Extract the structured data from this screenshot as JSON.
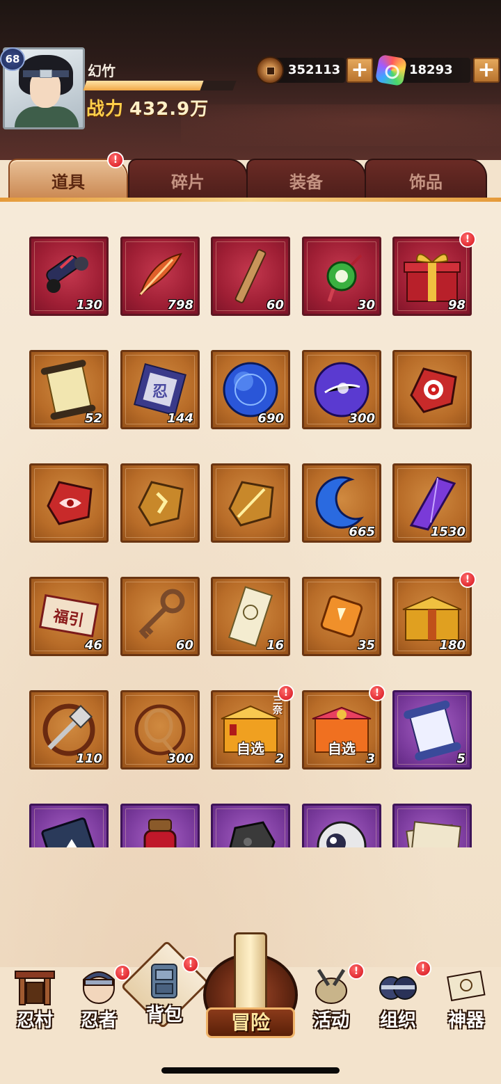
{
  "player": {
    "level": "68",
    "name": "幻竹",
    "power_label": "战力",
    "power_value": "432.9万",
    "exp_progress": 0.78
  },
  "currencies": {
    "copper": {
      "icon": "copper-coin-icon",
      "value": "352113"
    },
    "gem": {
      "icon": "rainbow-gem-icon",
      "value": "18293"
    },
    "add_label": "+"
  },
  "tabs": [
    {
      "label": "道具",
      "active": true,
      "badge": "!"
    },
    {
      "label": "碎片",
      "active": false
    },
    {
      "label": "装备",
      "active": false
    },
    {
      "label": "饰品",
      "active": false
    }
  ],
  "items": [
    {
      "icon": "scroll-icon",
      "frame": "red",
      "count": "130"
    },
    {
      "icon": "feather-icon",
      "frame": "red",
      "count": "798"
    },
    {
      "icon": "wooden-stick-icon",
      "frame": "red",
      "count": "60"
    },
    {
      "icon": "jade-pendant-icon",
      "frame": "red",
      "count": "30"
    },
    {
      "icon": "gift-box-icon",
      "frame": "red",
      "count": "98",
      "badge": "!"
    },
    {
      "icon": "open-scroll-icon",
      "frame": "brown",
      "count": "52"
    },
    {
      "icon": "talisman-cloth-icon",
      "frame": "brown",
      "count": "144"
    },
    {
      "icon": "blue-orb-icon",
      "frame": "brown",
      "count": "690"
    },
    {
      "icon": "purple-orb-icon",
      "frame": "brown",
      "count": "300"
    },
    {
      "icon": "red-target-stone-icon",
      "frame": "brown",
      "count": ""
    },
    {
      "icon": "red-eye-stone-icon",
      "frame": "brown",
      "count": ""
    },
    {
      "icon": "gold-rune-stone-icon",
      "frame": "brown",
      "count": ""
    },
    {
      "icon": "gold-blade-stone-icon",
      "frame": "brown",
      "count": ""
    },
    {
      "icon": "crescent-moon-icon",
      "frame": "brown",
      "count": "665"
    },
    {
      "icon": "purple-crystal-icon",
      "frame": "brown",
      "count": "1530"
    },
    {
      "icon": "fortune-banner-icon",
      "frame": "brown",
      "count": "46",
      "text": "福引"
    },
    {
      "icon": "bronze-key-icon",
      "frame": "brown",
      "count": "60"
    },
    {
      "icon": "paper-charm-icon",
      "frame": "brown",
      "count": "16"
    },
    {
      "icon": "amber-cube-icon",
      "frame": "brown",
      "count": "35"
    },
    {
      "icon": "golden-box-icon",
      "frame": "brown",
      "count": "180",
      "badge": "!"
    },
    {
      "icon": "shuriken-whirl-icon",
      "frame": "brown",
      "count": "110"
    },
    {
      "icon": "rope-whirl-icon",
      "frame": "brown",
      "count": "300"
    },
    {
      "icon": "select-chest-icon",
      "frame": "brown",
      "count": "2",
      "tag": "自选",
      "side": "三奈",
      "badge": "!"
    },
    {
      "icon": "select-chest-red-icon",
      "frame": "brown",
      "count": "3",
      "tag": "自选",
      "badge": "!"
    },
    {
      "icon": "blue-scroll-icon",
      "frame": "purple",
      "count": "5"
    },
    {
      "icon": "book-icon",
      "frame": "purple",
      "count": ""
    },
    {
      "icon": "potion-jar-icon",
      "frame": "purple",
      "count": ""
    },
    {
      "icon": "dark-ore-icon",
      "frame": "purple",
      "count": ""
    },
    {
      "icon": "eyeball-icon",
      "frame": "purple",
      "count": ""
    },
    {
      "icon": "paper-bundle-icon",
      "frame": "purple",
      "count": ""
    }
  ],
  "nav": [
    {
      "key": "village",
      "label": "忍村",
      "icon": "village-gate-icon"
    },
    {
      "key": "ninja",
      "label": "忍者",
      "icon": "ninja-head-icon",
      "badge": "!"
    },
    {
      "key": "bag",
      "label": "背包",
      "icon": "backpack-icon",
      "badge": "!",
      "active": true
    },
    {
      "key": "adventure",
      "label": "冒险",
      "icon": "adventure-scroll-icon"
    },
    {
      "key": "events",
      "label": "活动",
      "icon": "kunai-drum-icon",
      "badge": "!"
    },
    {
      "key": "guild",
      "label": "组织",
      "icon": "guild-masks-icon",
      "badge": "!"
    },
    {
      "key": "artifact",
      "label": "神器",
      "icon": "artifact-scroll-icon"
    }
  ]
}
